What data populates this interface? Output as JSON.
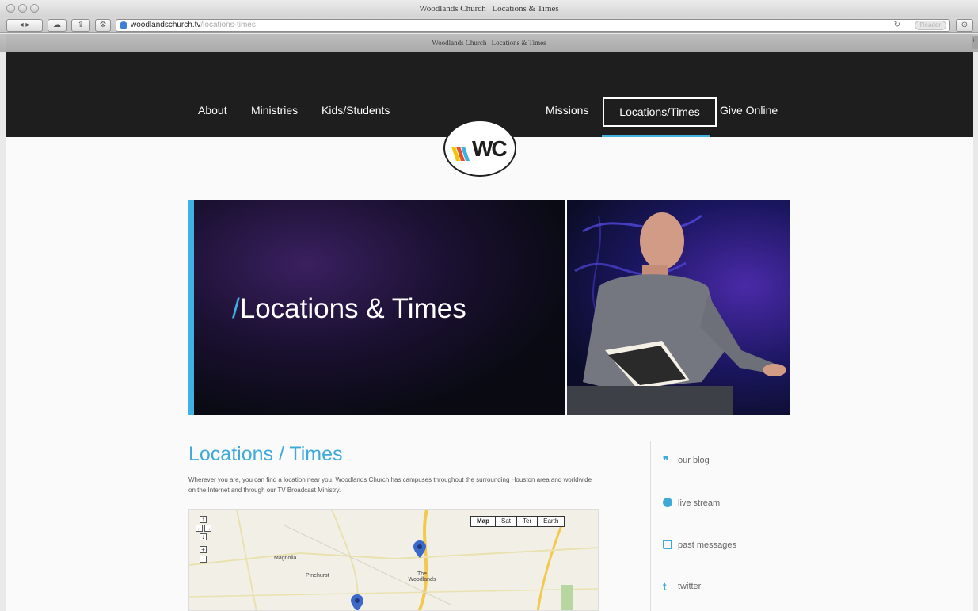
{
  "browser": {
    "window_title": "Woodlands Church | Locations & Times",
    "url_host": "woodlandschurch.tv",
    "url_path": "/locations-times",
    "reader_label": "Reader",
    "tab_title": "Woodlands Church | Locations & Times"
  },
  "nav": {
    "items": [
      "About",
      "Ministries",
      "Kids/Students",
      "Missions",
      "Locations/Times",
      "Give Online"
    ],
    "active_item": "Locations/Times",
    "logo_text": "WC"
  },
  "hero": {
    "slash": "/",
    "title": "Locations & Times"
  },
  "content": {
    "heading": "Locations / Times",
    "intro": "Wherever you are, you can find a location near you. Woodlands Church has campuses throughout the surrounding Houston area and worldwide on the Internet and through our TV Broadcast Ministry."
  },
  "map": {
    "type_buttons": [
      "Map",
      "Sat",
      "Ter",
      "Earth"
    ],
    "labels": [
      "Magnolia",
      "Pinehurst",
      "The Woodlands"
    ]
  },
  "sidebar": {
    "links": [
      {
        "label": "our blog",
        "icon": "quote-icon"
      },
      {
        "label": "live stream",
        "icon": "globe-icon"
      },
      {
        "label": "past messages",
        "icon": "monitor-icon"
      },
      {
        "label": "twitter",
        "icon": "twitter-icon"
      }
    ]
  },
  "colors": {
    "accent": "#3fb1e3",
    "nav_bg": "#1e1e1e",
    "heading": "#3fa9d8"
  }
}
